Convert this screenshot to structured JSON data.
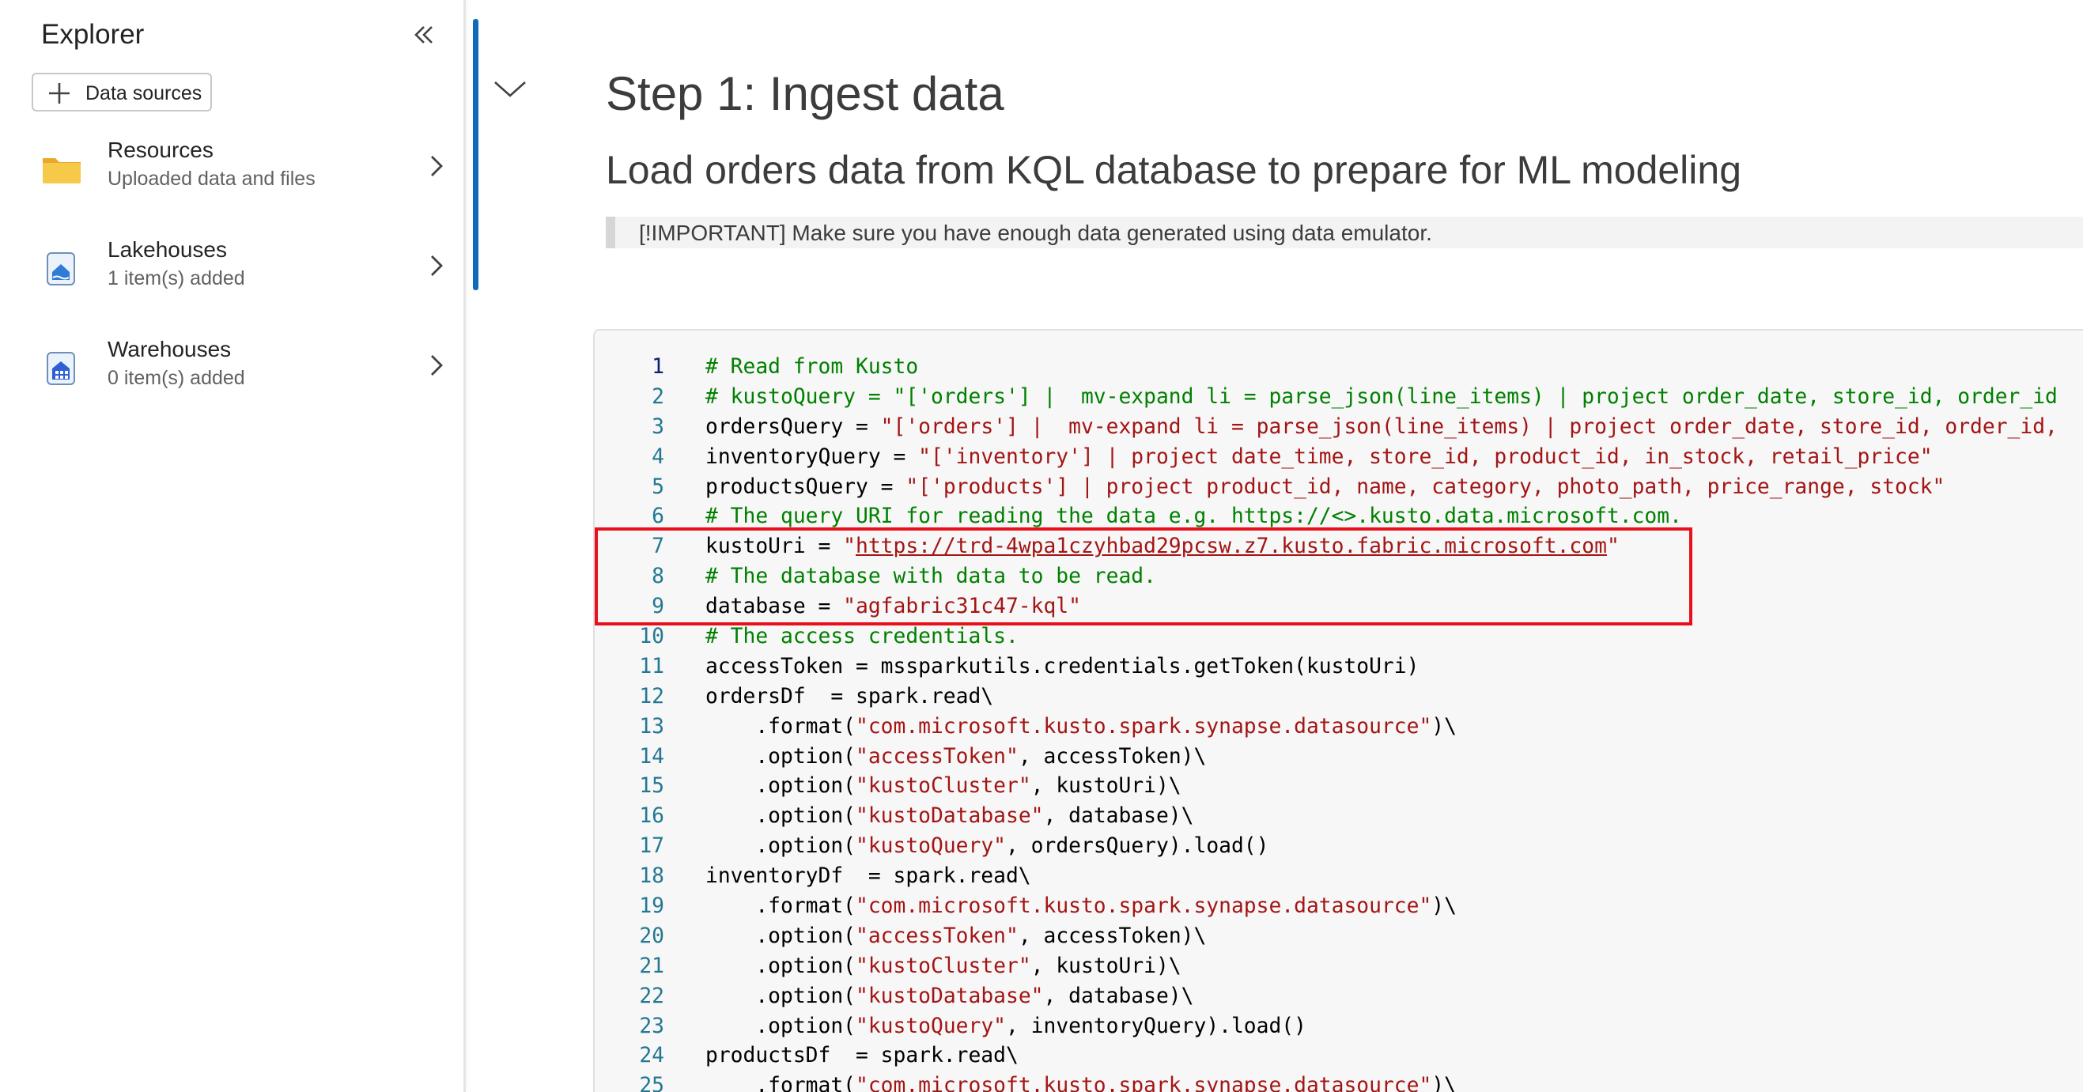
{
  "explorer": {
    "title": "Explorer",
    "collapse_icon": "double-chevron-left-icon",
    "data_sources_button": {
      "label": "Data sources",
      "icon": "plus-icon"
    },
    "items": [
      {
        "name": "Resources",
        "subtitle": "Uploaded data and files",
        "icon": "folder-icon"
      },
      {
        "name": "Lakehouses",
        "subtitle": "1 item(s) added",
        "icon": "lakehouse-icon"
      },
      {
        "name": "Warehouses",
        "subtitle": "0 item(s) added",
        "icon": "warehouse-icon"
      }
    ]
  },
  "markdown": {
    "heading": "Step 1: Ingest data",
    "subheading": "Load orders data from KQL database to prepare for ML modeling",
    "note": "[!IMPORTANT] Make sure you have enough data generated using data emulator."
  },
  "code": {
    "highlighted_lines": [
      7,
      8,
      9
    ],
    "lines": [
      {
        "n": "1",
        "parts": [
          {
            "t": "c",
            "v": "# Read from Kusto"
          }
        ]
      },
      {
        "n": "2",
        "parts": [
          {
            "t": "c",
            "v": "# kustoQuery = \"['orders'] |  mv-expand li = parse_json(line_items) | project order_date, store_id, order_id"
          }
        ]
      },
      {
        "n": "3",
        "parts": [
          {
            "t": "p",
            "v": "ordersQuery = "
          },
          {
            "t": "s",
            "v": "\"['orders'] |  mv-expand li = parse_json(line_items) | project order_date, store_id, order_id,"
          }
        ]
      },
      {
        "n": "4",
        "parts": [
          {
            "t": "p",
            "v": "inventoryQuery = "
          },
          {
            "t": "s",
            "v": "\"['inventory'] | project date_time, store_id, product_id, in_stock, retail_price\""
          }
        ]
      },
      {
        "n": "5",
        "parts": [
          {
            "t": "p",
            "v": "productsQuery = "
          },
          {
            "t": "s",
            "v": "\"['products'] | project product_id, name, category, photo_path, price_range, stock\""
          }
        ]
      },
      {
        "n": "6",
        "parts": [
          {
            "t": "c",
            "v": "# The query URI for reading the data e.g. https://<>.kusto.data.microsoft.com."
          }
        ]
      },
      {
        "n": "7",
        "parts": [
          {
            "t": "p",
            "v": "kustoUri = "
          },
          {
            "t": "s",
            "v": "\""
          },
          {
            "t": "u",
            "v": "https://trd-4wpa1czyhbad29pcsw.z7.kusto.fabric.microsoft.com"
          },
          {
            "t": "s",
            "v": "\""
          }
        ]
      },
      {
        "n": "8",
        "parts": [
          {
            "t": "c",
            "v": "# The database with data to be read."
          }
        ]
      },
      {
        "n": "9",
        "parts": [
          {
            "t": "p",
            "v": "database = "
          },
          {
            "t": "s",
            "v": "\"agfabric31c47-kql\""
          }
        ]
      },
      {
        "n": "10",
        "parts": [
          {
            "t": "c",
            "v": "# The access credentials."
          }
        ]
      },
      {
        "n": "11",
        "parts": [
          {
            "t": "p",
            "v": "accessToken = mssparkutils.credentials.getToken(kustoUri)"
          }
        ]
      },
      {
        "n": "12",
        "parts": [
          {
            "t": "p",
            "v": "ordersDf  = spark.read\\"
          }
        ]
      },
      {
        "n": "13",
        "parts": [
          {
            "t": "p",
            "v": "    .format("
          },
          {
            "t": "s",
            "v": "\"com.microsoft.kusto.spark.synapse.datasource\""
          },
          {
            "t": "p",
            "v": ")\\"
          }
        ]
      },
      {
        "n": "14",
        "parts": [
          {
            "t": "p",
            "v": "    .option("
          },
          {
            "t": "s",
            "v": "\"accessToken\""
          },
          {
            "t": "p",
            "v": ", accessToken)\\"
          }
        ]
      },
      {
        "n": "15",
        "parts": [
          {
            "t": "p",
            "v": "    .option("
          },
          {
            "t": "s",
            "v": "\"kustoCluster\""
          },
          {
            "t": "p",
            "v": ", kustoUri)\\"
          }
        ]
      },
      {
        "n": "16",
        "parts": [
          {
            "t": "p",
            "v": "    .option("
          },
          {
            "t": "s",
            "v": "\"kustoDatabase\""
          },
          {
            "t": "p",
            "v": ", database)\\"
          }
        ]
      },
      {
        "n": "17",
        "parts": [
          {
            "t": "p",
            "v": "    .option("
          },
          {
            "t": "s",
            "v": "\"kustoQuery\""
          },
          {
            "t": "p",
            "v": ", ordersQuery).load()"
          }
        ]
      },
      {
        "n": "18",
        "parts": [
          {
            "t": "p",
            "v": "inventoryDf  = spark.read\\"
          }
        ]
      },
      {
        "n": "19",
        "parts": [
          {
            "t": "p",
            "v": "    .format("
          },
          {
            "t": "s",
            "v": "\"com.microsoft.kusto.spark.synapse.datasource\""
          },
          {
            "t": "p",
            "v": ")\\"
          }
        ]
      },
      {
        "n": "20",
        "parts": [
          {
            "t": "p",
            "v": "    .option("
          },
          {
            "t": "s",
            "v": "\"accessToken\""
          },
          {
            "t": "p",
            "v": ", accessToken)\\"
          }
        ]
      },
      {
        "n": "21",
        "parts": [
          {
            "t": "p",
            "v": "    .option("
          },
          {
            "t": "s",
            "v": "\"kustoCluster\""
          },
          {
            "t": "p",
            "v": ", kustoUri)\\"
          }
        ]
      },
      {
        "n": "22",
        "parts": [
          {
            "t": "p",
            "v": "    .option("
          },
          {
            "t": "s",
            "v": "\"kustoDatabase\""
          },
          {
            "t": "p",
            "v": ", database)\\"
          }
        ]
      },
      {
        "n": "23",
        "parts": [
          {
            "t": "p",
            "v": "    .option("
          },
          {
            "t": "s",
            "v": "\"kustoQuery\""
          },
          {
            "t": "p",
            "v": ", inventoryQuery).load()"
          }
        ]
      },
      {
        "n": "24",
        "parts": [
          {
            "t": "p",
            "v": "productsDf  = spark.read\\"
          }
        ]
      },
      {
        "n": "25",
        "parts": [
          {
            "t": "p",
            "v": "    .format("
          },
          {
            "t": "s",
            "v": "\"com.microsoft.kusto.spark.synapse.datasource\""
          },
          {
            "t": "p",
            "v": ")\\"
          }
        ]
      }
    ]
  },
  "colors": {
    "accent": "#0f6cbd",
    "highlight_box": "#e8101b",
    "comment": "#008000",
    "string": "#a31515",
    "line_number": "#237893"
  }
}
